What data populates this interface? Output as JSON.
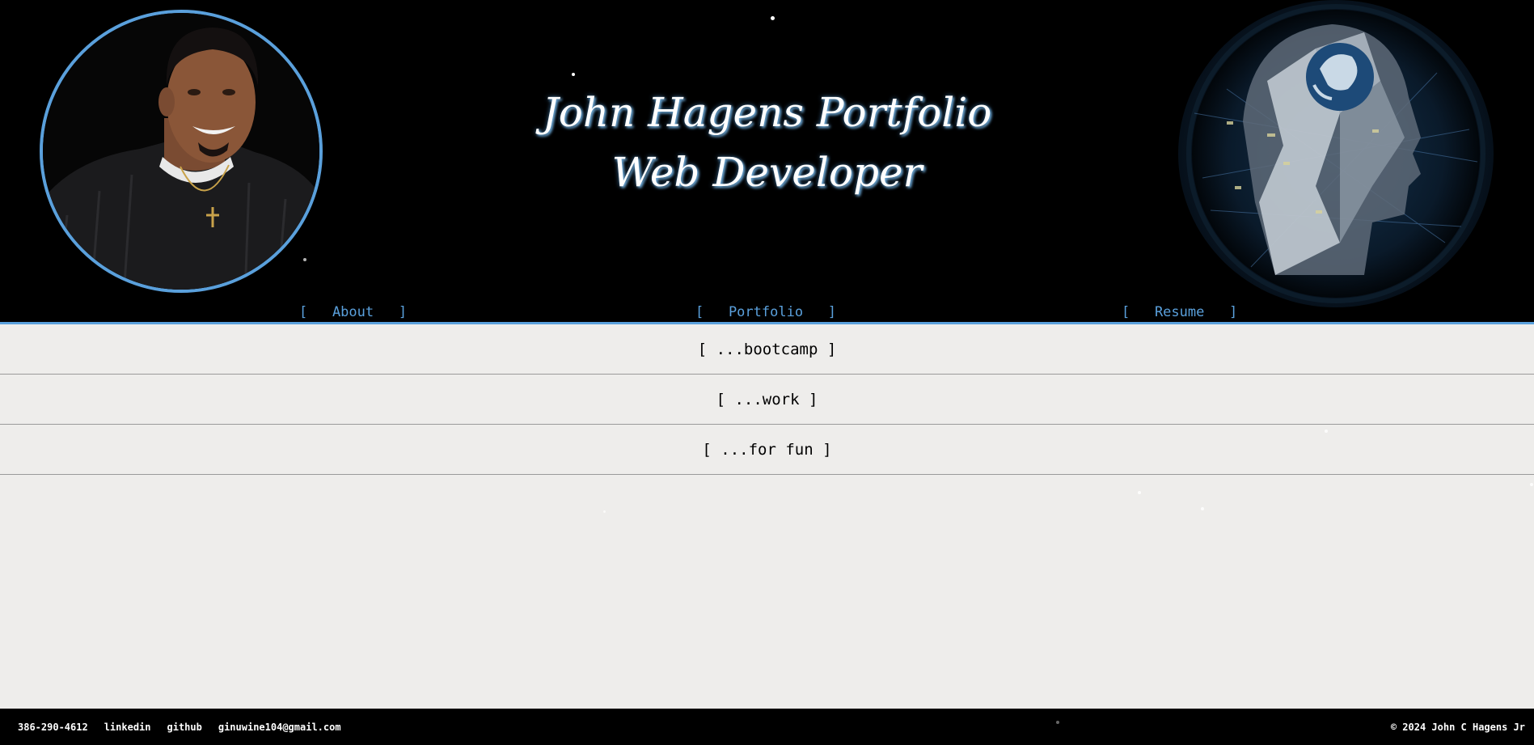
{
  "header": {
    "title_line1": "John Hagens Portfolio",
    "title_line2": "Web Developer"
  },
  "nav": {
    "about": "[   About   ]",
    "portfolio": "[   Portfolio   ]",
    "resume": "[   Resume   ]"
  },
  "sections": {
    "bootcamp": "[ ...bootcamp ]",
    "work": "[ ...work ]",
    "fun": "[ ...for fun ]"
  },
  "footer": {
    "phone": "386-290-4612",
    "linkedin": "linkedin",
    "github": "github",
    "email": "ginuwine104@gmail.com",
    "copyright": "© 2024 John C Hagens Jr"
  },
  "colors": {
    "accent": "#5aa0dc",
    "header_bg": "#000000",
    "body_bg": "#eeedeb"
  },
  "icons": {
    "profile": "profile-photo",
    "head": "digital-head-globe-image"
  }
}
